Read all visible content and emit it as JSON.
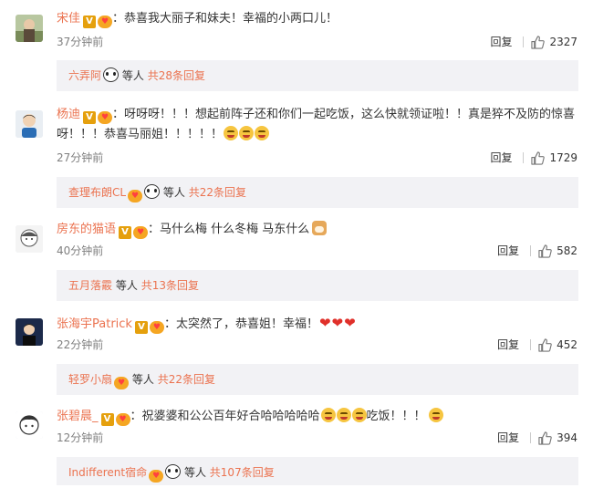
{
  "comments": [
    {
      "user": "宋佳",
      "text": "：恭喜我大丽子和妹夫！幸福的小两口儿！",
      "time": "37分钟前",
      "reply_label": "回复",
      "likes": "2327",
      "sub": {
        "name": "六弄阿",
        "etc": "等人",
        "more": "共28条回复"
      }
    },
    {
      "user": "杨迪",
      "text": "：呀呀呀！！！想起前阵子还和你们一起吃饭，这么快就领证啦！！真是猝不及防的惊喜呀！！！恭喜马丽姐！！！！！",
      "time": "27分钟前",
      "reply_label": "回复",
      "likes": "1729",
      "sub": {
        "name": "查理布朗CL",
        "etc": "等人",
        "more": "共22条回复"
      }
    },
    {
      "user": "房东的猫语",
      "text": "：马什么梅 什么冬梅 马东什么",
      "time": "40分钟前",
      "reply_label": "回复",
      "likes": "582",
      "sub": {
        "name": "五月落霰",
        "etc": "等人",
        "more": "共13条回复"
      }
    },
    {
      "user": "张海宇Patrick",
      "text": "：太突然了，恭喜姐！幸福！",
      "time": "22分钟前",
      "reply_label": "回复",
      "likes": "452",
      "sub": {
        "name": "轻罗小扇",
        "etc": "等人",
        "more": "共22条回复"
      }
    },
    {
      "user": "张碧晨_",
      "text": "：祝婆婆和公公百年好合哈哈哈哈哈",
      "text2": "吃饭！！！",
      "time": "12分钟前",
      "reply_label": "回复",
      "likes": "394",
      "sub": {
        "name": "Indifferent宿命",
        "etc": "等人",
        "more": "共107条回复"
      }
    }
  ],
  "colors": {
    "username": "#eb7350",
    "reply_bg": "#f2f2f5",
    "verified": "#e5a00d"
  },
  "icons": [
    "verified-badge-icon",
    "fan-badge-icon",
    "thumbs-up-icon",
    "grin-emoji-icon",
    "heart-emoji-icon",
    "dog-emoji-icon",
    "panda-emoji-icon"
  ]
}
